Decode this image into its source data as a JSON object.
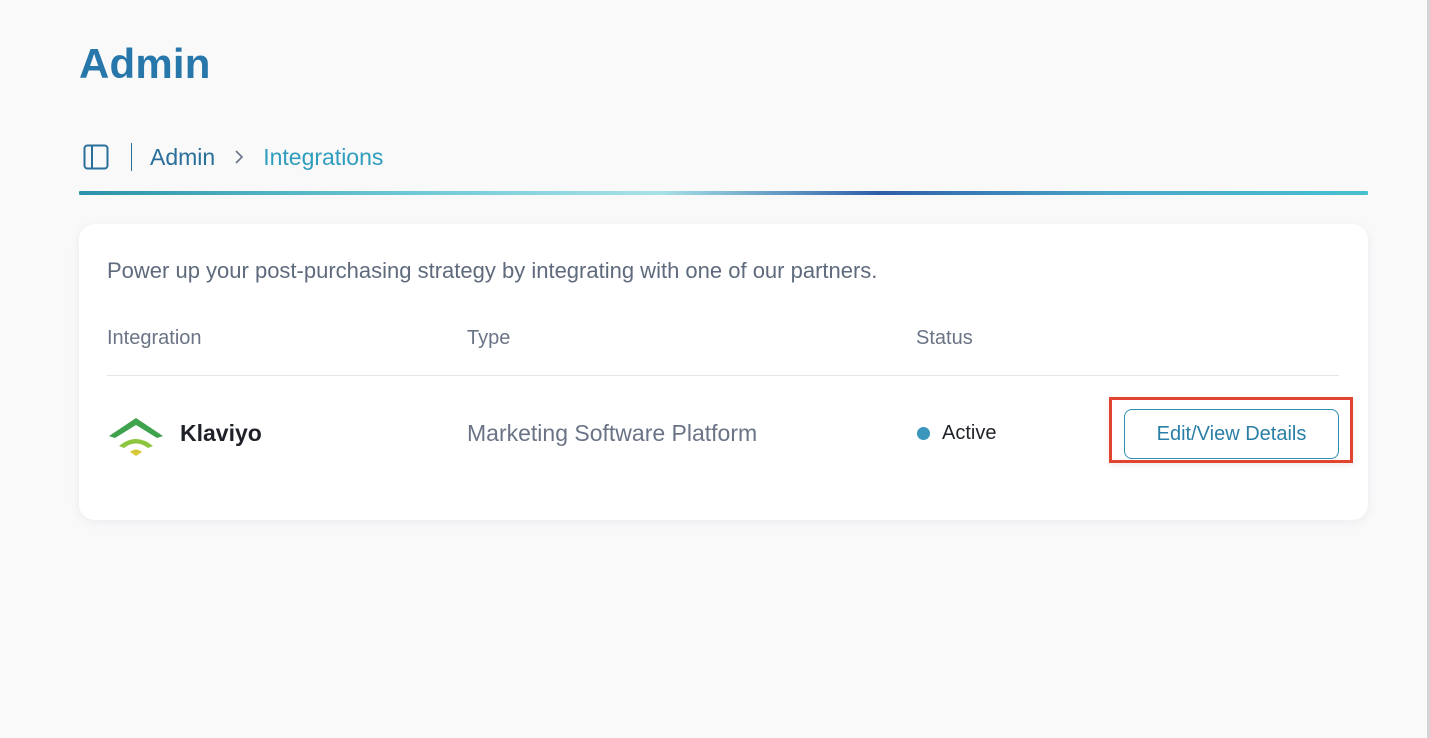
{
  "page": {
    "title": "Admin"
  },
  "breadcrumb": {
    "toggle_icon": "sidebar-toggle-icon",
    "items": [
      {
        "label": "Admin"
      },
      {
        "label": "Integrations"
      }
    ],
    "separator_icon": "chevron-right-icon"
  },
  "card": {
    "intro": "Power up your post-purchasing strategy by integrating with one of our partners.",
    "columns": {
      "integration": "Integration",
      "type": "Type",
      "status": "Status"
    },
    "rows": [
      {
        "logo_icon": "klaviyo-logo-icon",
        "name": "Klaviyo",
        "type": "Marketing Software Platform",
        "status": "Active",
        "action_label": "Edit/View Details"
      }
    ]
  },
  "colors": {
    "title": "#2877ab",
    "breadcrumb_link": "#2a6f9a",
    "breadcrumb_current": "#2f9dbd",
    "status_active": "#3a96bd",
    "highlight": "#e2452f",
    "logo_dark_green": "#3fa34d",
    "logo_light_green": "#8cc63f",
    "logo_yellow": "#d7c93a"
  }
}
